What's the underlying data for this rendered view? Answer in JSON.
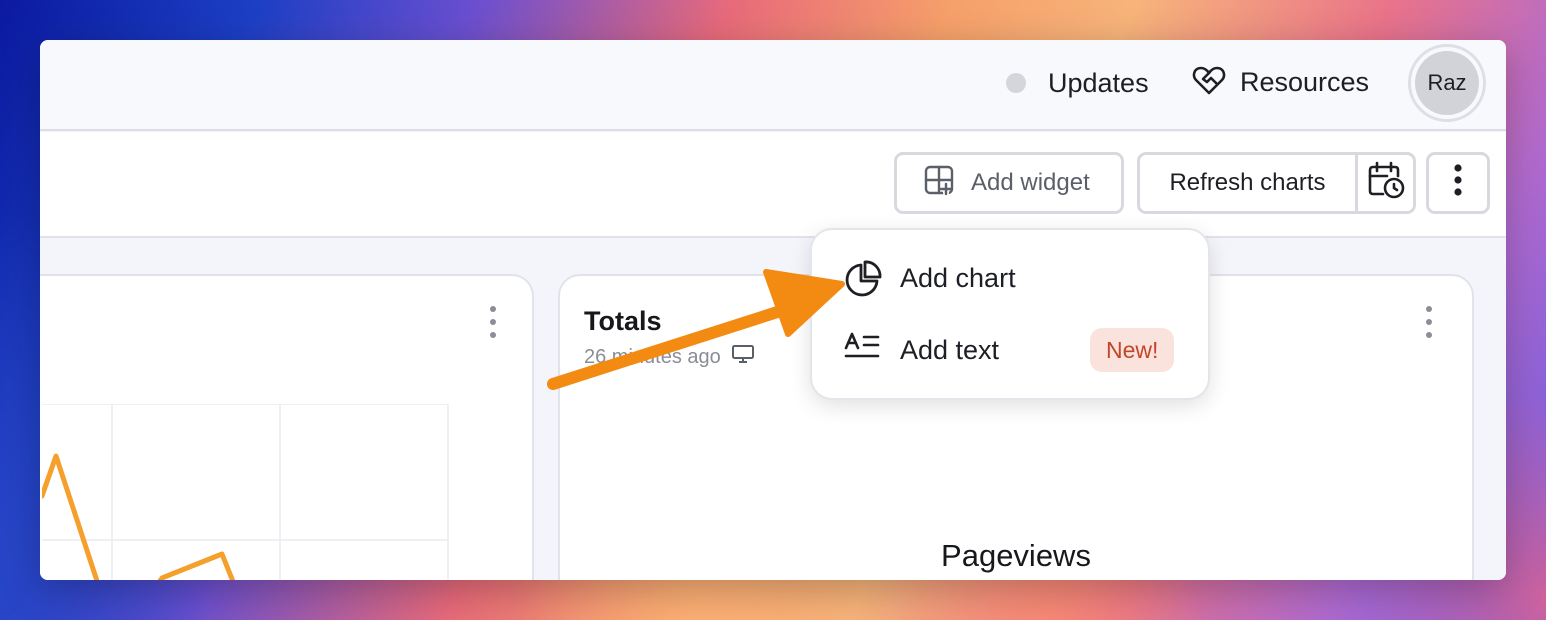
{
  "topbar": {
    "updates_label": "Updates",
    "resources_label": "Resources",
    "avatar_initials": "Raz"
  },
  "toolbar": {
    "add_widget_label": "Add widget",
    "refresh_label": "Refresh charts"
  },
  "cards": {
    "right": {
      "title": "Totals",
      "subtitle": "26 minutes ago",
      "metric_label": "Pageviews"
    }
  },
  "menu": {
    "items": [
      {
        "label": "Add chart",
        "icon": "pie-chart-icon"
      },
      {
        "label": "Add text",
        "icon": "text-icon",
        "badge": "New!"
      }
    ]
  },
  "colors": {
    "chart_line": "#f5a02c",
    "arrow": "#f38a12",
    "badge_bg": "#fbe3dd",
    "badge_text": "#c2462a"
  }
}
